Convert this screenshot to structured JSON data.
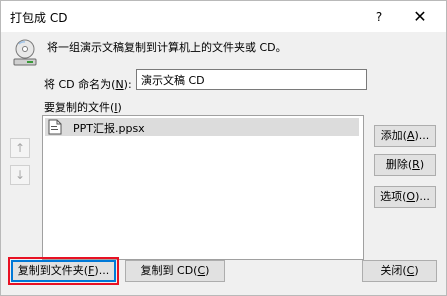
{
  "window": {
    "title": "打包成 CD",
    "help_label": "?",
    "close_label": "✕"
  },
  "intro": "将一组演示文稿复制到计算机上的文件夹或 CD。",
  "cd_name": {
    "label_prefix": "将 CD 命名为(",
    "mnemonic": "N",
    "label_suffix": "):",
    "value": "演示文稿 CD"
  },
  "files": {
    "label_prefix": "要复制的文件(",
    "mnemonic": "I",
    "label_suffix": ")",
    "items": [
      {
        "name": "PPT汇报.ppsx",
        "selected": true
      }
    ]
  },
  "order_buttons": {
    "up_label": "↑",
    "down_label": "↓"
  },
  "side_buttons": [
    {
      "prefix": "添加(",
      "mnemonic": "A",
      "suffix": ")..."
    },
    {
      "prefix": "删除(",
      "mnemonic": "R",
      "suffix": ")"
    },
    {
      "prefix": "选项(",
      "mnemonic": "O",
      "suffix": ")..."
    }
  ],
  "bottom_buttons": {
    "copy_folder": {
      "prefix": "复制到文件夹(",
      "mnemonic": "F",
      "suffix": ")..."
    },
    "copy_cd": {
      "prefix": "复制到 CD(",
      "mnemonic": "C",
      "suffix": ")"
    },
    "close": {
      "prefix": "关闭(",
      "mnemonic": "C",
      "suffix": ")"
    }
  },
  "colors": {
    "accent": "#0078d7",
    "highlight": "#e81123",
    "selection": "#dcdcdc"
  }
}
